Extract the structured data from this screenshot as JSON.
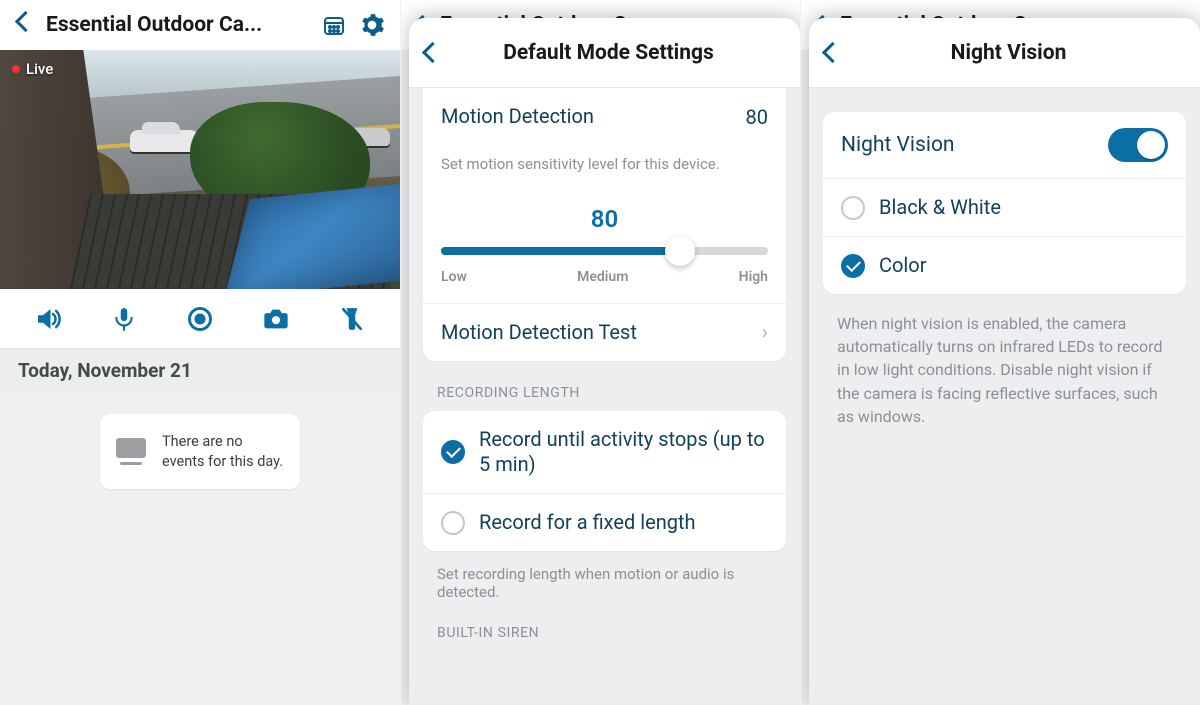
{
  "colors": {
    "accent": "#0B6FA4",
    "textDark": "#13405a",
    "muted": "#8c9094"
  },
  "screen1": {
    "header": {
      "title": "Essential Outdoor Ca..."
    },
    "live_label": "Live",
    "date_label": "Today, November 21",
    "no_events_text": "There are no events for this day."
  },
  "screen2": {
    "bg_header_title": "Essential Outdoor Ca...",
    "sheet_title": "Default Mode Settings",
    "motion": {
      "label": "Motion Detection",
      "value": "80",
      "help": "Set motion sensitivity level for this device.",
      "slider_value": "80",
      "low": "Low",
      "medium": "Medium",
      "high": "High",
      "test_label": "Motion Detection Test"
    },
    "recording": {
      "section": "RECORDING LENGTH",
      "opt1": "Record until activity stops (up to 5 min)",
      "opt2": "Record for a fixed length",
      "help": "Set recording length when motion or audio is detected."
    },
    "siren_section": "BUILT-IN SIREN"
  },
  "screen3": {
    "bg_header_title": "Essential Outdoor Ca...",
    "sheet_title": "Night Vision",
    "toggle_label": "Night Vision",
    "opt_bw": "Black & White",
    "opt_color": "Color",
    "description": "When night vision is enabled, the camera automatically turns on infrared LEDs to record in low light conditions. Disable night vision if the camera is facing reflective surfaces, such as windows."
  }
}
